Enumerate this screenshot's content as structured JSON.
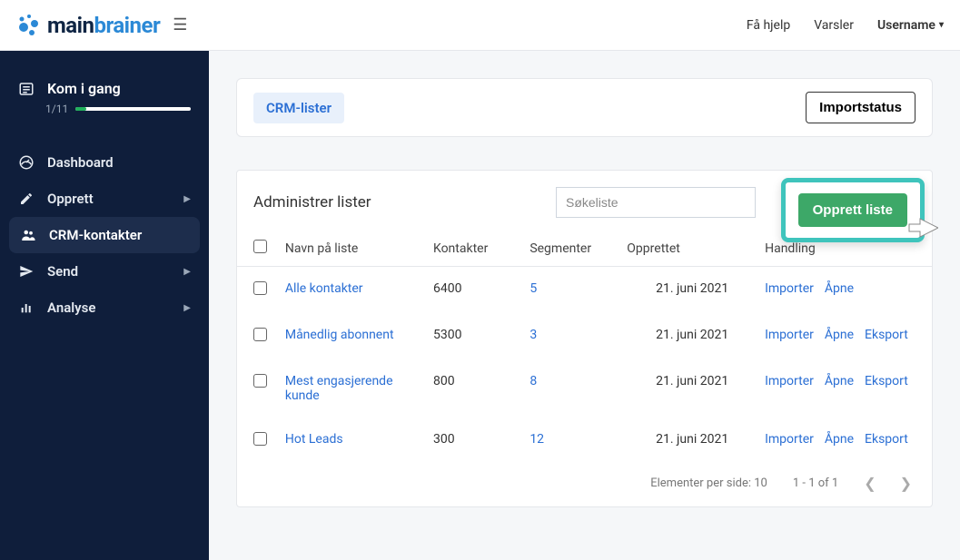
{
  "topbar": {
    "logo_main": "main",
    "logo_brainer": "brainer",
    "help": "Få hjelp",
    "alerts": "Varsler",
    "username": "Username"
  },
  "sidebar": {
    "getting_started": {
      "title": "Kom i gang",
      "progress_text": "1/11"
    },
    "items": [
      {
        "label": "Dashboard",
        "expandable": false
      },
      {
        "label": "Opprett",
        "expandable": true
      },
      {
        "label": "CRM-kontakter",
        "expandable": false,
        "active": true
      },
      {
        "label": "Send",
        "expandable": true
      },
      {
        "label": "Analyse",
        "expandable": true
      }
    ]
  },
  "panel": {
    "tab_label": "CRM-lister",
    "import_status": "Importstatus",
    "title": "Administrer lister",
    "search_placeholder": "Søkeliste",
    "create_button": "Opprett liste",
    "columns": {
      "name": "Navn på liste",
      "contacts": "Kontakter",
      "segments": "Segmenter",
      "created": "Opprettet",
      "actions": "Handling"
    },
    "rows": [
      {
        "name": "Alle kontakter",
        "contacts": "6400",
        "segments": "5",
        "created": "21. juni 2021",
        "import": "Importer",
        "open": "Åpne",
        "export": ""
      },
      {
        "name": "Månedlig abonnent",
        "contacts": "5300",
        "segments": "3",
        "created": "21. juni 2021",
        "import": "Importer",
        "open": "Åpne",
        "export": "Eksport"
      },
      {
        "name": "Mest engasjerende kunde",
        "contacts": "800",
        "segments": "8",
        "created": "21. juni 2021",
        "import": "Importer",
        "open": "Åpne",
        "export": "Eksport"
      },
      {
        "name": "Hot Leads",
        "contacts": "300",
        "segments": "12",
        "created": "21. juni 2021",
        "import": "Importer",
        "open": "Åpne",
        "export": "Eksport"
      }
    ],
    "pager": {
      "per_page_label": "Elementer per side: 10",
      "range": "1 - 1 of 1"
    }
  }
}
